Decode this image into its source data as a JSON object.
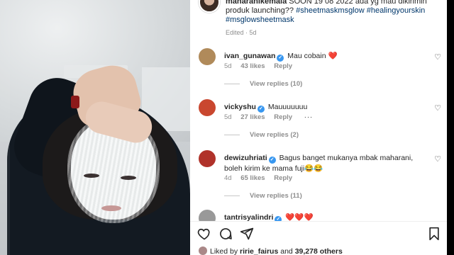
{
  "caption": {
    "username": "maharanikemala",
    "text": "SOON 19 08 2022 ada yg mau dikirimin produk launching??",
    "hashtags": [
      "#sheetmaskmsglow",
      "#healingyourskin",
      "#msglowsheetmask"
    ],
    "meta": "Edited · 5d"
  },
  "comments": [
    {
      "username": "ivan_gunawan",
      "text": "Mau cobain ❤️",
      "age": "5d",
      "likes": "43 likes",
      "reply_label": "Reply",
      "view_replies": "View replies (10)",
      "avatar_color": "#b08a5a"
    },
    {
      "username": "vickyshu",
      "text": "Mauuuuuuu",
      "age": "5d",
      "likes": "27 likes",
      "reply_label": "Reply",
      "more": "···",
      "view_replies": "View replies (2)",
      "avatar_color": "#c9472f"
    },
    {
      "username": "dewizuhriati",
      "text": "Bagus banget mukanya mbak maharani, boleh kirim ke mama fuji😂😂",
      "age": "4d",
      "likes": "65 likes",
      "reply_label": "Reply",
      "view_replies": "View replies (11)",
      "avatar_color": "#b0322a"
    },
    {
      "username": "tantrisyalindri",
      "text": "❤️❤️❤️",
      "avatar_color": "#999999"
    }
  ],
  "likes_summary": {
    "prefix": "Liked by",
    "user": "ririe_fairus",
    "joiner": "and",
    "count": "39,278 others"
  },
  "icons": {
    "like": "heart-icon",
    "comment": "comment-icon",
    "share": "share-icon",
    "save": "bookmark-icon"
  }
}
